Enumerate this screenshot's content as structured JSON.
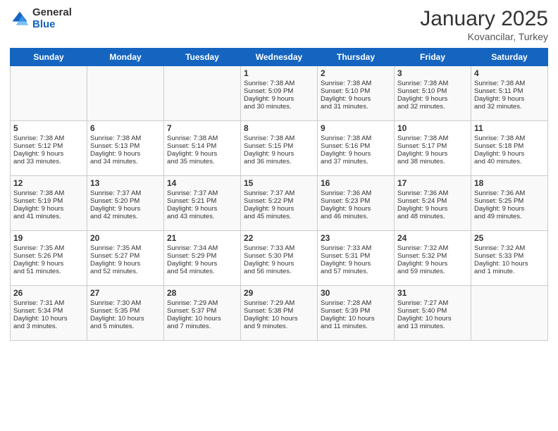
{
  "logo": {
    "general": "General",
    "blue": "Blue"
  },
  "header": {
    "month": "January 2025",
    "location": "Kovancilar, Turkey"
  },
  "weekdays": [
    "Sunday",
    "Monday",
    "Tuesday",
    "Wednesday",
    "Thursday",
    "Friday",
    "Saturday"
  ],
  "weeks": [
    [
      {
        "day": "",
        "content": ""
      },
      {
        "day": "",
        "content": ""
      },
      {
        "day": "",
        "content": ""
      },
      {
        "day": "1",
        "content": "Sunrise: 7:38 AM\nSunset: 5:09 PM\nDaylight: 9 hours\nand 30 minutes."
      },
      {
        "day": "2",
        "content": "Sunrise: 7:38 AM\nSunset: 5:10 PM\nDaylight: 9 hours\nand 31 minutes."
      },
      {
        "day": "3",
        "content": "Sunrise: 7:38 AM\nSunset: 5:10 PM\nDaylight: 9 hours\nand 32 minutes."
      },
      {
        "day": "4",
        "content": "Sunrise: 7:38 AM\nSunset: 5:11 PM\nDaylight: 9 hours\nand 32 minutes."
      }
    ],
    [
      {
        "day": "5",
        "content": "Sunrise: 7:38 AM\nSunset: 5:12 PM\nDaylight: 9 hours\nand 33 minutes."
      },
      {
        "day": "6",
        "content": "Sunrise: 7:38 AM\nSunset: 5:13 PM\nDaylight: 9 hours\nand 34 minutes."
      },
      {
        "day": "7",
        "content": "Sunrise: 7:38 AM\nSunset: 5:14 PM\nDaylight: 9 hours\nand 35 minutes."
      },
      {
        "day": "8",
        "content": "Sunrise: 7:38 AM\nSunset: 5:15 PM\nDaylight: 9 hours\nand 36 minutes."
      },
      {
        "day": "9",
        "content": "Sunrise: 7:38 AM\nSunset: 5:16 PM\nDaylight: 9 hours\nand 37 minutes."
      },
      {
        "day": "10",
        "content": "Sunrise: 7:38 AM\nSunset: 5:17 PM\nDaylight: 9 hours\nand 38 minutes."
      },
      {
        "day": "11",
        "content": "Sunrise: 7:38 AM\nSunset: 5:18 PM\nDaylight: 9 hours\nand 40 minutes."
      }
    ],
    [
      {
        "day": "12",
        "content": "Sunrise: 7:38 AM\nSunset: 5:19 PM\nDaylight: 9 hours\nand 41 minutes."
      },
      {
        "day": "13",
        "content": "Sunrise: 7:37 AM\nSunset: 5:20 PM\nDaylight: 9 hours\nand 42 minutes."
      },
      {
        "day": "14",
        "content": "Sunrise: 7:37 AM\nSunset: 5:21 PM\nDaylight: 9 hours\nand 43 minutes."
      },
      {
        "day": "15",
        "content": "Sunrise: 7:37 AM\nSunset: 5:22 PM\nDaylight: 9 hours\nand 45 minutes."
      },
      {
        "day": "16",
        "content": "Sunrise: 7:36 AM\nSunset: 5:23 PM\nDaylight: 9 hours\nand 46 minutes."
      },
      {
        "day": "17",
        "content": "Sunrise: 7:36 AM\nSunset: 5:24 PM\nDaylight: 9 hours\nand 48 minutes."
      },
      {
        "day": "18",
        "content": "Sunrise: 7:36 AM\nSunset: 5:25 PM\nDaylight: 9 hours\nand 49 minutes."
      }
    ],
    [
      {
        "day": "19",
        "content": "Sunrise: 7:35 AM\nSunset: 5:26 PM\nDaylight: 9 hours\nand 51 minutes."
      },
      {
        "day": "20",
        "content": "Sunrise: 7:35 AM\nSunset: 5:27 PM\nDaylight: 9 hours\nand 52 minutes."
      },
      {
        "day": "21",
        "content": "Sunrise: 7:34 AM\nSunset: 5:29 PM\nDaylight: 9 hours\nand 54 minutes."
      },
      {
        "day": "22",
        "content": "Sunrise: 7:33 AM\nSunset: 5:30 PM\nDaylight: 9 hours\nand 56 minutes."
      },
      {
        "day": "23",
        "content": "Sunrise: 7:33 AM\nSunset: 5:31 PM\nDaylight: 9 hours\nand 57 minutes."
      },
      {
        "day": "24",
        "content": "Sunrise: 7:32 AM\nSunset: 5:32 PM\nDaylight: 9 hours\nand 59 minutes."
      },
      {
        "day": "25",
        "content": "Sunrise: 7:32 AM\nSunset: 5:33 PM\nDaylight: 10 hours\nand 1 minute."
      }
    ],
    [
      {
        "day": "26",
        "content": "Sunrise: 7:31 AM\nSunset: 5:34 PM\nDaylight: 10 hours\nand 3 minutes."
      },
      {
        "day": "27",
        "content": "Sunrise: 7:30 AM\nSunset: 5:35 PM\nDaylight: 10 hours\nand 5 minutes."
      },
      {
        "day": "28",
        "content": "Sunrise: 7:29 AM\nSunset: 5:37 PM\nDaylight: 10 hours\nand 7 minutes."
      },
      {
        "day": "29",
        "content": "Sunrise: 7:29 AM\nSunset: 5:38 PM\nDaylight: 10 hours\nand 9 minutes."
      },
      {
        "day": "30",
        "content": "Sunrise: 7:28 AM\nSunset: 5:39 PM\nDaylight: 10 hours\nand 11 minutes."
      },
      {
        "day": "31",
        "content": "Sunrise: 7:27 AM\nSunset: 5:40 PM\nDaylight: 10 hours\nand 13 minutes."
      },
      {
        "day": "",
        "content": ""
      }
    ]
  ]
}
